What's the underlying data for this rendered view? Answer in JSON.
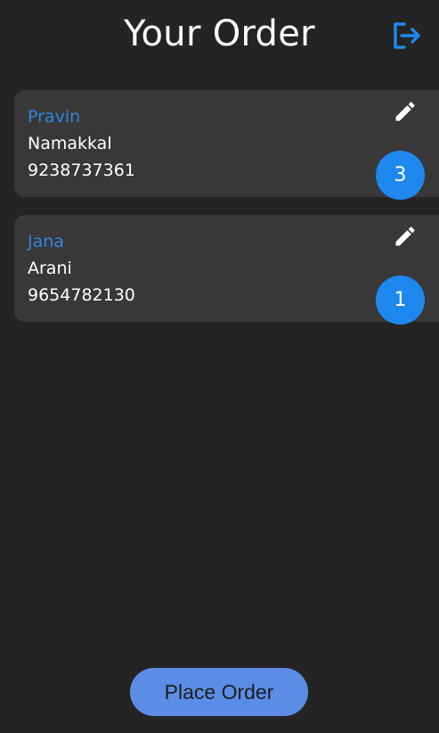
{
  "header": {
    "title": "Your Order",
    "logout_icon": "logout-icon"
  },
  "orders": [
    {
      "name": "Pravin",
      "city": "Namakkal",
      "phone": "9238737361",
      "quantity": "3",
      "edit_icon": "pencil-icon"
    },
    {
      "name": "Jana",
      "city": "Arani",
      "phone": "9654782130",
      "quantity": "1",
      "edit_icon": "pencil-icon"
    }
  ],
  "footer": {
    "place_order_label": "Place Order"
  },
  "colors": {
    "background": "#242424",
    "card": "#383838",
    "accent_blue": "#1e88ef",
    "name_blue": "#2f86e0",
    "button": "#5b8de6"
  }
}
